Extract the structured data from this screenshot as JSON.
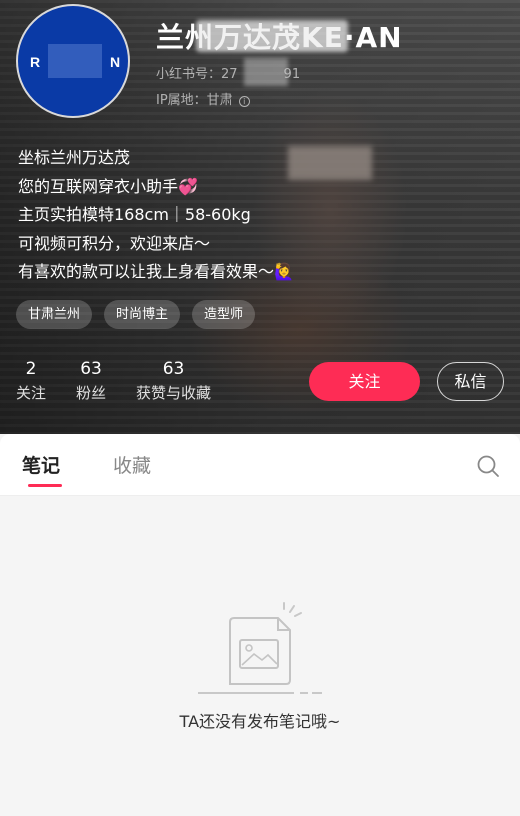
{
  "profile": {
    "avatar_letters": [
      "R",
      "N"
    ],
    "name": "兰州万达茂KE·AN",
    "id_label": "小红书号：27",
    "id_tail": "91",
    "ip_label": "IP属地：甘肃",
    "bio_lines": [
      "坐标兰州万达茂",
      "您的互联网穿衣小助手💞",
      "主页实拍模特168cm｜58-60kg",
      "可视频可积分，欢迎来店～",
      "有喜欢的款可以让我上身看看效果～🙋‍♀️"
    ],
    "tags": [
      "甘肃兰州",
      "时尚博主",
      "造型师"
    ],
    "stats": [
      {
        "num": "2",
        "label": "关注"
      },
      {
        "num": "63",
        "label": "粉丝"
      },
      {
        "num": "63",
        "label": "获赞与收藏"
      }
    ],
    "follow_label": "关注",
    "message_label": "私信"
  },
  "tabs": {
    "notes": "笔记",
    "collections": "收藏"
  },
  "empty_state": {
    "text": "TA还没有发布笔记哦~"
  },
  "colors": {
    "accent": "#fe2c55",
    "avatar_bg": "#0a3aa6"
  },
  "icons": {
    "search": "search-icon",
    "info": "info-icon",
    "empty": "empty-document-icon"
  }
}
